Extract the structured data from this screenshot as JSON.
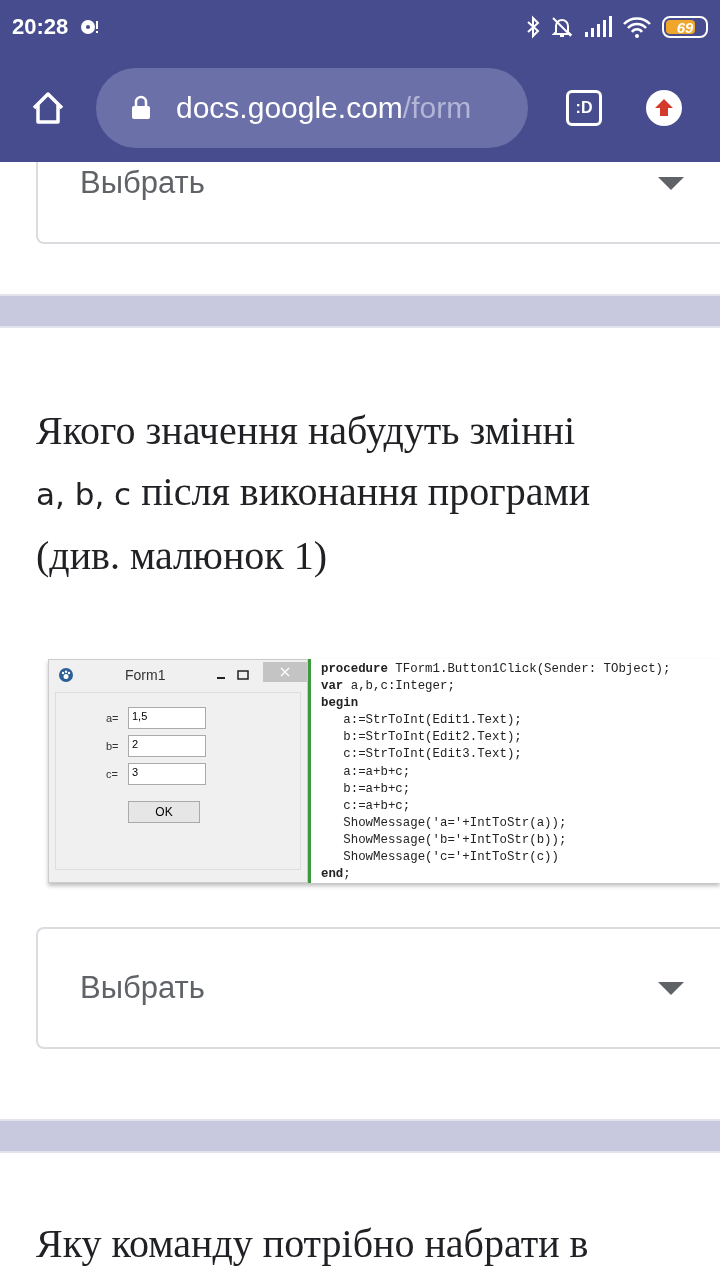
{
  "status_bar": {
    "time": "20:28",
    "battery": "69"
  },
  "browser": {
    "url_host": "docs.google.com",
    "url_path": "/form",
    "tab_badge": ":D"
  },
  "questions": [
    {
      "kind": "select_only",
      "select": {
        "placeholder": "Выбрать"
      }
    },
    {
      "kind": "question",
      "line_1": "Якого значення набудуть змінні",
      "variables": "a, b, c",
      "line_2_rest": "після виконання програми",
      "line_3": "(див. малюнок 1)",
      "figure": {
        "form": {
          "title": "Form1",
          "fields": [
            {
              "label": "a=",
              "value": "1,5"
            },
            {
              "label": "b=",
              "value": "2"
            },
            {
              "label": "c=",
              "value": "3"
            }
          ],
          "button": "OK"
        },
        "code": [
          "**procedure** TForm1.Button1Click(Sender: TObject);",
          "**var** a,b,c:Integer;",
          "**begin**",
          "   a:=StrToInt(Edit1.Text);",
          "   b:=StrToInt(Edit2.Text);",
          "   c:=StrToInt(Edit3.Text);",
          "   a:=a+b+c;",
          "   b:=a+b+c;",
          "   c:=a+b+c;",
          "   ShowMessage('a='+IntToStr(a));",
          "   ShowMessage('b='+IntToStr(b));",
          "   ShowMessage('c='+IntToStr(c))",
          "**end**;"
        ]
      },
      "select": {
        "placeholder": "Выбрать"
      }
    },
    {
      "kind": "title_only",
      "line_1": "Яку команду потрібно набрати в"
    }
  ]
}
